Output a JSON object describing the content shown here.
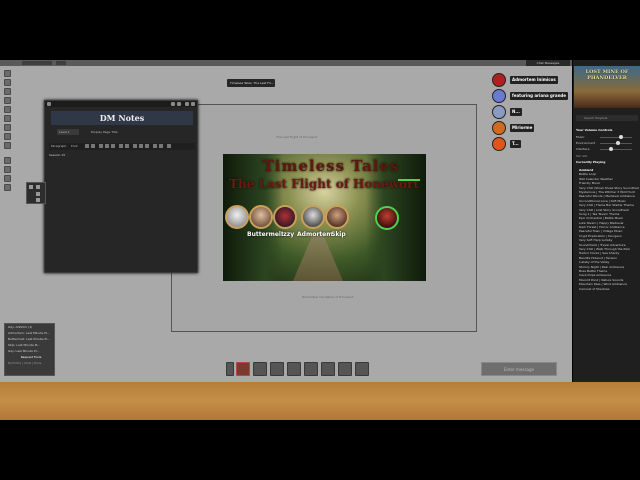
{
  "topbar": {
    "hud_button": "Chat Messages"
  },
  "scene": {
    "tab_label": "Timeless Tales: The Last Fli...",
    "caption_top": "The Last Flight of Honewort",
    "caption_bottom": "Remember the Name of Honewort"
  },
  "poster": {
    "title": "Timeless Tales",
    "subtitle": "The Last Flight of Honewort",
    "characters": [
      {
        "name": ""
      },
      {
        "name": "Buttermelt"
      },
      {
        "name": "Izzy"
      },
      {
        "name": "Admortem"
      },
      {
        "name": "Skip"
      },
      {
        "name": ""
      }
    ]
  },
  "dm_notes": {
    "title": "DM Notes",
    "level_select": "Level 1",
    "display_label": "Display Page Title",
    "style_select": "Paragraph",
    "font_select": "Font",
    "body_heading": "Session 15"
  },
  "party": [
    {
      "name": "Admortem Inimicos",
      "color": "#b02020"
    },
    {
      "name": "featuring ariana grande",
      "color": "#6a7ad0"
    },
    {
      "name": "N...",
      "color": "#8a9ac0"
    },
    {
      "name": "Miriorme",
      "color": "#d06a20"
    },
    {
      "name": "T...",
      "color": "#e0561a"
    }
  ],
  "right_panel": {
    "cover_title": "LOST MINE OF PHANDELVER",
    "search_placeholder": "Search Playlists",
    "volume_header": "Your Volume Controls",
    "volume_rows": [
      {
        "label": "Music",
        "value": 0.6
      },
      {
        "label": "Environment",
        "value": 0.5
      },
      {
        "label": "Interface",
        "value": 0.3
      }
    ],
    "level_label": "Vol. Vol.",
    "currently_playing": "Currently Playing",
    "playlists_label": "Ambient",
    "tracks": [
      "Battle Loop",
      "Wet Calendar Weather",
      "Friendly Music",
      "Very Chill (Shrek Shrek Story Soundtrack)",
      "Mysterious | The Witcher 3 Wild Hunt",
      "Peaceful Woods | Medieval Ambience",
      "Unconditional Love | Soft Music",
      "Very Chill | Flame Bar Starter Theme",
      "Very Chill | Lost Story Soundtrack",
      "Song 1 | Tea Tavern Theme",
      "Epic Orchestral | Battle Music",
      "Lute Tavern | Happy Medieval",
      "Dark Forest | Horror Ambience",
      "Peaceful Town | Village Music",
      "Crypt Exploration | Dungeon",
      "Very Soft Harp Lullaby",
      "Soundcheck | Travel Adventure",
      "Very Chill | Walk Through the Park",
      "Harbor Docks | Sea Shanty",
      "Bandits Hideout | Tension",
      "Lullaby of the Valley",
      "Stormy Night | Rain Ambience",
      "Boss Battle Theme",
      "Cave Drips Ambience",
      "Moonlit Pond | Nature Sounds",
      "Mountain Pass | Wind Ambience",
      "Carnival of Shadows"
    ]
  },
  "chat": {
    "lines": [
      "Izzy: Ahhhhh (1)",
      "Admortem: Last Minute Pl...",
      "Buttermelt: Last Minute Pl...",
      "Skip: Last Minute Pl...",
      "Izzy: Last Minute Pl..."
    ],
    "request_button": "Request Tools",
    "footer": "Roll Dice  | Chat  | Tools"
  },
  "enter_message": "Enter message"
}
